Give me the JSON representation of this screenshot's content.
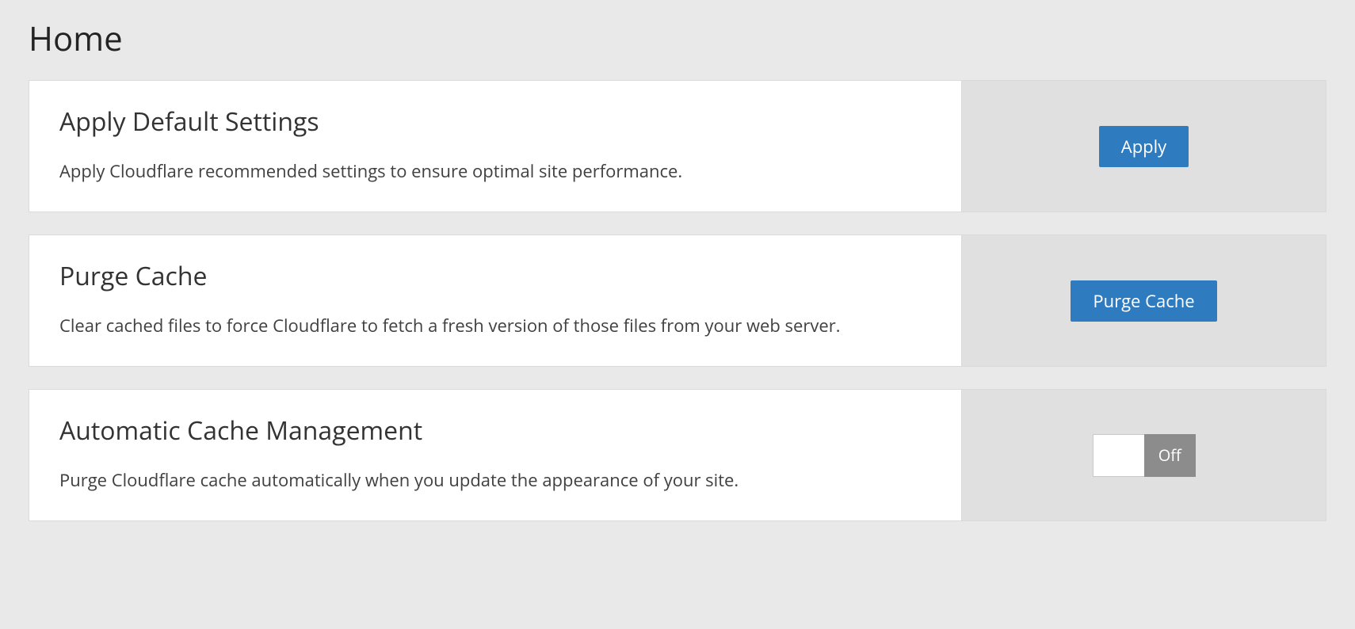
{
  "page": {
    "title": "Home"
  },
  "cards": {
    "apply_defaults": {
      "title": "Apply Default Settings",
      "desc": "Apply Cloudflare recommended settings to ensure optimal site performance.",
      "button_label": "Apply"
    },
    "purge_cache": {
      "title": "Purge Cache",
      "desc": "Clear cached files to force Cloudflare to fetch a fresh version of those files from your web server.",
      "button_label": "Purge Cache"
    },
    "auto_cache": {
      "title": "Automatic Cache Management",
      "desc": "Purge Cloudflare cache automatically when you update the appearance of your site.",
      "toggle_state": "Off"
    }
  }
}
